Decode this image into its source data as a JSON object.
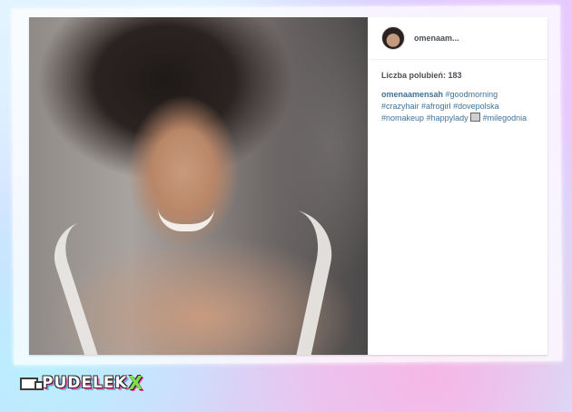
{
  "post": {
    "username": "omenaam...",
    "likes_label": "Liczba polubień: 183",
    "caption_author": "omenaamensah",
    "hashtags": [
      "#goodmorning",
      "#crazyhair",
      "#afrogirl",
      "#dovepolska",
      "#nomakeup",
      "#happylady",
      "#milegodnia"
    ]
  },
  "watermark": {
    "logo_text": "PUDELEK",
    "logo_suffix": "X"
  },
  "colors": {
    "link": "#3f729b",
    "text": "#4a4f55"
  }
}
